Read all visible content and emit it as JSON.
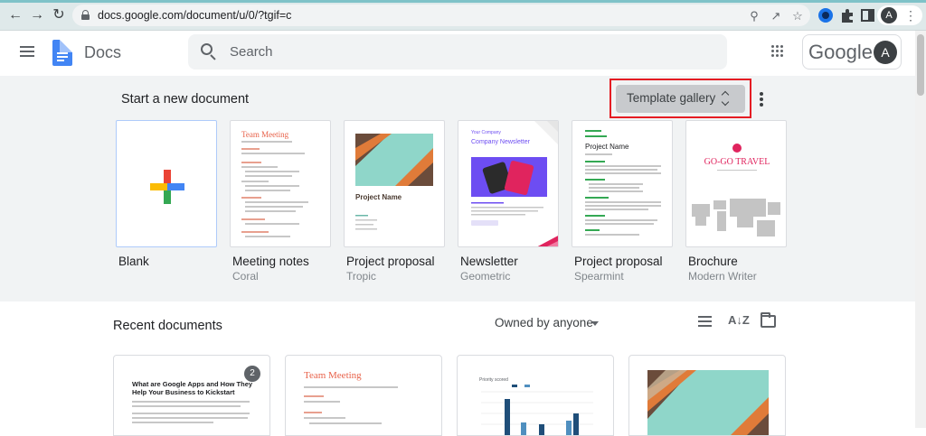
{
  "browser": {
    "url": "docs.google.com/document/u/0/?tgif=c"
  },
  "header": {
    "app_name": "Docs",
    "search_placeholder": "Search",
    "google_label": "Google",
    "account_initial": "A"
  },
  "templates": {
    "section_title": "Start a new document",
    "gallery_label": "Template gallery",
    "items": [
      {
        "name": "Blank",
        "subtitle": ""
      },
      {
        "name": "Meeting notes",
        "subtitle": "Coral"
      },
      {
        "name": "Project proposal",
        "subtitle": "Tropic"
      },
      {
        "name": "Newsletter",
        "subtitle": "Geometric"
      },
      {
        "name": "Project proposal",
        "subtitle": "Spearmint"
      },
      {
        "name": "Brochure",
        "subtitle": "Modern Writer"
      }
    ],
    "thumb_text": {
      "meeting_title": "Team Meeting",
      "tropic_title": "Project Name",
      "newsletter_company": "Your Company",
      "newsletter_title": "Company Newsletter",
      "spearmint_title": "Project Name",
      "brochure_title": "GO-GO TRAVEL"
    }
  },
  "recent": {
    "title": "Recent documents",
    "owner_filter": "Owned by anyone",
    "docs": [
      {
        "heading": "What are Google Apps and How They Help Your Business to Kickstart",
        "badge": "2"
      },
      {
        "heading": "Team Meeting"
      },
      {
        "heading": "Priority scored"
      },
      {
        "heading": ""
      }
    ]
  },
  "colors": {
    "accent_blue": "#4285f4",
    "highlight_red": "#e51c23",
    "coral": "#e8624a",
    "tropic_teal": "#8fd6c9",
    "tropic_brown": "#6b4c3b",
    "tropic_orange": "#e07b39",
    "newsletter_purple": "#6d4df2",
    "spearmint_green": "#34a853",
    "brochure_pink": "#e0245e"
  },
  "icons": [
    "back-icon",
    "forward-icon",
    "reload-icon",
    "lock-icon",
    "zoom-icon",
    "share-icon",
    "star-icon",
    "extension-icon",
    "puzzle-icon",
    "sidepanel-icon",
    "hamburger-icon",
    "docs-logo-icon",
    "search-icon",
    "apps-grid-icon",
    "unfold-icon",
    "more-vert-icon",
    "list-view-icon",
    "sort-az-icon",
    "folder-icon"
  ]
}
